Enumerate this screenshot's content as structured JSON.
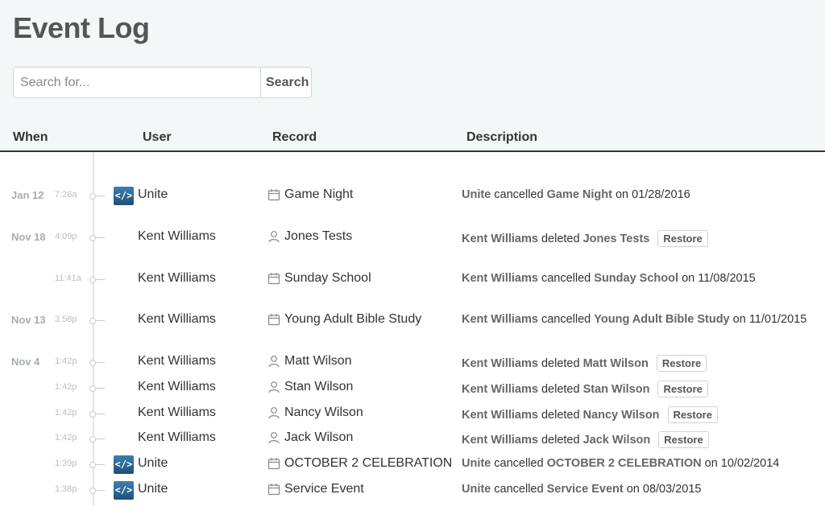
{
  "page": {
    "title": "Event Log"
  },
  "search": {
    "placeholder": "Search for...",
    "value": "",
    "button_label": "Search"
  },
  "table": {
    "headers": [
      "When",
      "User",
      "Record",
      "Description"
    ],
    "rows": [
      {
        "date": "Jan 12",
        "time": "7:26a",
        "user": "Unite",
        "user_is_app": true,
        "record": "Game Night",
        "record_icon": "calendar-icon",
        "desc_actor": "Unite",
        "desc_verb": "cancelled",
        "desc_target": "Game Night",
        "desc_suffix": "on 01/28/2016",
        "restore_label": ""
      },
      {
        "date": "Nov 18",
        "time": "4:09p",
        "user": "Kent Williams",
        "user_is_app": false,
        "record": "Jones Tests",
        "record_icon": "person-icon",
        "desc_actor": "Kent Williams",
        "desc_verb": "deleted",
        "desc_target": "Jones Tests",
        "desc_suffix": "",
        "restore_label": "Restore"
      },
      {
        "date": "",
        "time": "11:41a",
        "user": "Kent Williams",
        "user_is_app": false,
        "record": "Sunday School",
        "record_icon": "calendar-icon",
        "desc_actor": "Kent Williams",
        "desc_verb": "cancelled",
        "desc_target": "Sunday School",
        "desc_suffix": "on 11/08/2015",
        "restore_label": ""
      },
      {
        "date": "Nov 13",
        "time": "3:58p",
        "user": "Kent Williams",
        "user_is_app": false,
        "record": "Young Adult Bible Study",
        "record_icon": "calendar-icon",
        "desc_actor": "Kent Williams",
        "desc_verb": "cancelled",
        "desc_target": "Young Adult Bible Study",
        "desc_suffix": "on 11/01/2015",
        "restore_label": ""
      },
      {
        "date": "Nov 4",
        "time": "1:42p",
        "user": "Kent Williams",
        "user_is_app": false,
        "record": "Matt Wilson",
        "record_icon": "person-icon",
        "desc_actor": "Kent Williams",
        "desc_verb": "deleted",
        "desc_target": "Matt Wilson",
        "desc_suffix": "",
        "restore_label": "Restore"
      },
      {
        "date": "",
        "time": "1:42p",
        "user": "Kent Williams",
        "user_is_app": false,
        "record": "Stan Wilson",
        "record_icon": "person-icon",
        "desc_actor": "Kent Williams",
        "desc_verb": "deleted",
        "desc_target": "Stan Wilson",
        "desc_suffix": "",
        "restore_label": "Restore"
      },
      {
        "date": "",
        "time": "1:42p",
        "user": "Kent Williams",
        "user_is_app": false,
        "record": "Nancy Wilson",
        "record_icon": "person-icon",
        "desc_actor": "Kent Williams",
        "desc_verb": "deleted",
        "desc_target": "Nancy Wilson",
        "desc_suffix": "",
        "restore_label": "Restore"
      },
      {
        "date": "",
        "time": "1:42p",
        "user": "Kent Williams",
        "user_is_app": false,
        "record": "Jack Wilson",
        "record_icon": "person-icon",
        "desc_actor": "Kent Williams",
        "desc_verb": "deleted",
        "desc_target": "Jack Wilson",
        "desc_suffix": "",
        "restore_label": "Restore"
      },
      {
        "date": "",
        "time": "1:39p",
        "user": "Unite",
        "user_is_app": true,
        "record": "OCTOBER 2 CELEBRATION",
        "record_icon": "calendar-icon",
        "desc_actor": "Unite",
        "desc_verb": "cancelled",
        "desc_target": "OCTOBER 2 CELEBRATION",
        "desc_suffix": "on 10/02/2014",
        "restore_label": ""
      },
      {
        "date": "",
        "time": "1:38p",
        "user": "Unite",
        "user_is_app": true,
        "record": "Service Event",
        "record_icon": "calendar-icon",
        "desc_actor": "Unite",
        "desc_verb": "cancelled",
        "desc_target": "Service Event",
        "desc_suffix": "on 08/03/2015",
        "restore_label": ""
      }
    ]
  },
  "app_logo": {
    "icon": "code-brackets-icon",
    "glyph": "</>",
    "color": "#2c6594"
  },
  "colors": {
    "header_bg": "#f4f7f8",
    "title": "#555555",
    "accent_text": "#666666"
  }
}
